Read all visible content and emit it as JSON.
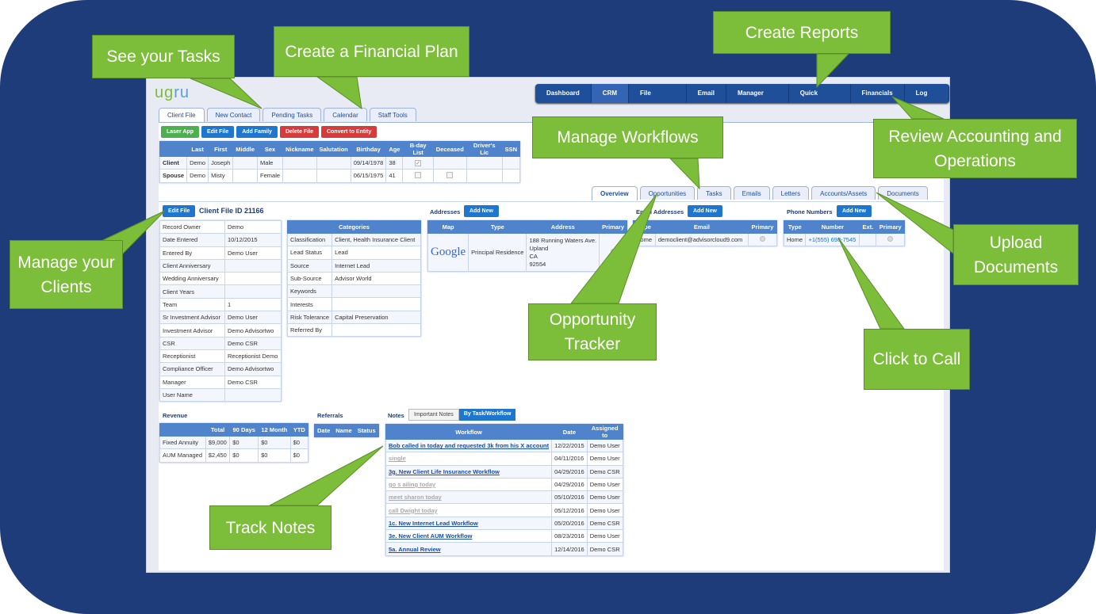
{
  "logo": {
    "text_a": "ug",
    "text_b": "ru"
  },
  "nav": [
    "Dashboard",
    "CRM",
    "File Manager",
    "Email",
    "Manager Tools",
    "Quick Reports",
    "Financials",
    "Log Out"
  ],
  "nav_active": "CRM",
  "tabs": [
    "Client File",
    "New Contact",
    "Pending Tasks",
    "Calendar",
    "Staff Tools"
  ],
  "actions": [
    "Laser App",
    "Edit File",
    "Add Family",
    "Delete File",
    "Convert to Entity"
  ],
  "family": {
    "headers": [
      "",
      "Last",
      "First",
      "Middle",
      "Sex",
      "Nickname",
      "Salutation",
      "Birthday",
      "Age",
      "B-day List",
      "Deceased",
      "Driver's Lic",
      "SSN"
    ],
    "rows": [
      [
        "Client",
        "Demo",
        "Joseph",
        "",
        "Male",
        "",
        "",
        "09/14/1978",
        "38"
      ],
      [
        "Spouse",
        "Demo",
        "Misty",
        "",
        "Female",
        "",
        "",
        "06/15/1975",
        "41"
      ]
    ]
  },
  "client_file": {
    "edit_label": "Edit File",
    "title": "Client File ID 21166"
  },
  "info": [
    [
      "Record Owner",
      "Demo"
    ],
    [
      "Date Entered",
      "10/12/2015"
    ],
    [
      "Entered By",
      "Demo User"
    ],
    [
      "Client Anniversary",
      ""
    ],
    [
      "Wedding Anniversary",
      ""
    ],
    [
      "Client Years",
      ""
    ],
    [
      "Team",
      "1"
    ],
    [
      "Sr Investment Advisor",
      "Demo User"
    ],
    [
      "Investment Advisor",
      "Demo Advisortwo"
    ],
    [
      "CSR",
      "Demo CSR"
    ],
    [
      "Receptionist",
      "Receptionist Demo"
    ],
    [
      "Compliance Officer",
      "Demo Advisortwo"
    ],
    [
      "Manager",
      "Demo CSR"
    ],
    [
      "User Name",
      ""
    ]
  ],
  "categories": {
    "header": "Categories",
    "rows": [
      [
        "Classification",
        "Client, Health Insurance Client"
      ],
      [
        "Lead Status",
        "Lead"
      ],
      [
        "Source",
        "Internet Lead"
      ],
      [
        "Sub-Source",
        "Advisor World"
      ],
      [
        "Keywords",
        ""
      ],
      [
        "Interests",
        ""
      ],
      [
        "Risk Tolerance",
        "Capital Preservation"
      ],
      [
        "Referred By",
        ""
      ]
    ]
  },
  "subtabs": [
    "Overview",
    "Opportunities",
    "Tasks",
    "Emails",
    "Letters",
    "Accounts/Assets",
    "Documents"
  ],
  "addresses": {
    "label": "Addresses",
    "add": "Add New",
    "headers": [
      "Map",
      "Type",
      "Address",
      "Primary"
    ],
    "map": "Google",
    "type": "Principal Residence",
    "address": [
      "188 Running Waters Ave.",
      "Upland",
      "CA",
      "92554"
    ]
  },
  "emails": {
    "label": "Email Addresses",
    "add": "Add New",
    "headers": [
      "Type",
      "Email",
      "Primary"
    ],
    "type": "Home",
    "email": "democlient@advisorcloud9.com"
  },
  "phones": {
    "label": "Phone Numbers",
    "add": "Add New",
    "headers": [
      "Type",
      "Number",
      "Ext.",
      "Primary"
    ],
    "type": "Home",
    "number": "+1(555) 698-7545"
  },
  "revenue": {
    "label": "Revenue",
    "headers": [
      "",
      "Total",
      "90 Days",
      "12 Month",
      "YTD"
    ],
    "rows": [
      [
        "Fixed Annuity",
        "$9,000",
        "$0",
        "$0",
        "$0"
      ],
      [
        "AUM Managed",
        "$2,450",
        "$0",
        "$0",
        "$0"
      ]
    ]
  },
  "referrals": {
    "label": "Referrals",
    "headers": [
      "Date",
      "Name",
      "Status"
    ]
  },
  "notes": {
    "label": "Notes",
    "toggle": [
      "Important Notes",
      "By Task/Workflow"
    ],
    "headers": [
      "Workflow",
      "Date",
      "Assigned to"
    ],
    "rows": [
      [
        "Bob called in today and requested 3k from his X account",
        "12/22/2015",
        "Demo User",
        false
      ],
      [
        "single",
        "04/11/2016",
        "Demo User",
        true
      ],
      [
        "3g. New Client Life Insurance Workflow",
        "04/29/2016",
        "Demo CSR",
        false
      ],
      [
        "go s ailing today",
        "04/29/2016",
        "Demo User",
        true
      ],
      [
        "meet sharon today",
        "05/10/2016",
        "Demo User",
        true
      ],
      [
        "call Dwight today",
        "05/12/2016",
        "Demo User",
        true
      ],
      [
        "1c. New Internet Lead Workflow",
        "05/20/2016",
        "Demo CSR",
        false
      ],
      [
        "3e. New Client AUM Workflow",
        "08/23/2016",
        "Demo User",
        false
      ],
      [
        "5a. Annual Review",
        "12/14/2016",
        "Demo CSR",
        false
      ]
    ]
  },
  "callouts": {
    "tasks": "See your Tasks",
    "plan": "Create a Financial Plan",
    "reports": "Create Reports",
    "workflows": "Manage Workflows",
    "accounting": "Review Accounting and Operations",
    "clients": "Manage your Clients",
    "documents": "Upload Documents",
    "opportunity": "Opportunity Tracker",
    "call": "Click to Call",
    "notes": "Track Notes"
  },
  "colors": {
    "frame": "#1f3c7a",
    "callout": "#7cbd3a",
    "header": "#4f84cc"
  }
}
